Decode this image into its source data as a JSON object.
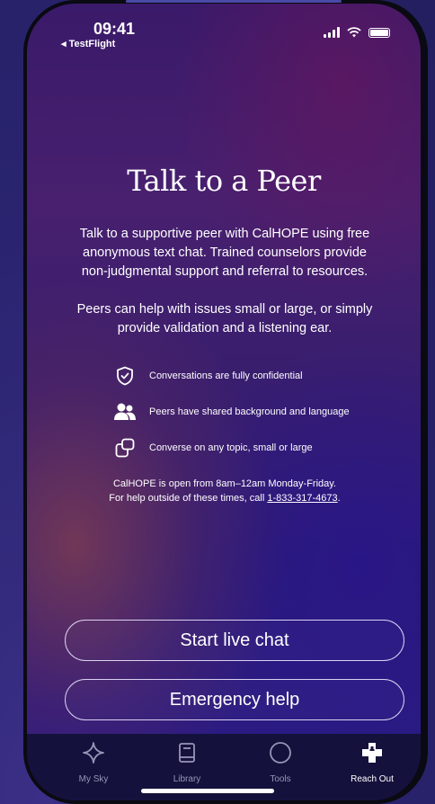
{
  "status_bar": {
    "time": "09:41",
    "back_app": "◂ TestFlight"
  },
  "main": {
    "title": "Talk to a Peer",
    "intro": "Talk to a supportive peer with CalHOPE using free anonymous text chat. Trained counselors provide non-judgmental support and referral to resources.",
    "intro2": "Peers can help with issues small or large, or simply provide validation and a listening ear.",
    "features": [
      {
        "icon": "shield-check-icon",
        "text": "Conversations are fully confidential"
      },
      {
        "icon": "people-icon",
        "text": "Peers have shared background and language"
      },
      {
        "icon": "chat-bubbles-icon",
        "text": "Converse on any topic, small or large"
      }
    ],
    "hours_line1": "CalHOPE is open from 8am–12am Monday-Friday.",
    "hours_line2_prefix": "For help outside of these times, call ",
    "phone": "1-833-317-4673",
    "hours_line2_suffix": "."
  },
  "buttons": {
    "live_chat": "Start live chat",
    "emergency": "Emergency help"
  },
  "tabbar": {
    "tabs": [
      {
        "label": "My Sky",
        "icon": "diamond-star-icon"
      },
      {
        "label": "Library",
        "icon": "book-icon"
      },
      {
        "label": "Tools",
        "icon": "circle-icon"
      },
      {
        "label": "Reach Out",
        "icon": "medical-cross-icon",
        "active": true
      }
    ]
  },
  "colors": {
    "accent": "#ffffff",
    "tabbar_bg": "#14123c",
    "inactive_tab": "#9894b8"
  }
}
